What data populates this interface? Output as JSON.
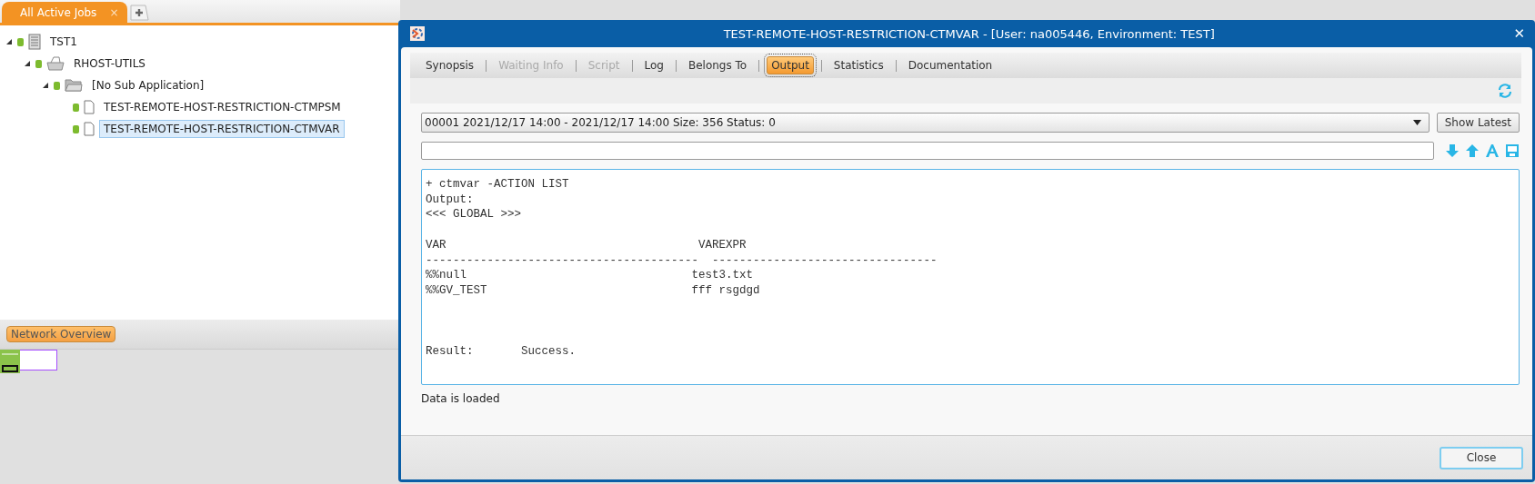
{
  "top_tabs": [
    {
      "label": "All Active Jobs",
      "selected": true,
      "close": "×"
    }
  ],
  "tree": [
    {
      "label": "TST1",
      "kind": "server",
      "expanded": true,
      "selected": false,
      "color": "#7dbb2e",
      "children": [
        {
          "label": "RHOST-UTILS",
          "kind": "application",
          "expanded": true,
          "selected": false,
          "color": "#7dbb2e",
          "children": [
            {
              "label": "[No Sub Application]",
              "kind": "folder",
              "expanded": true,
              "selected": false,
              "color": "#7dbb2e",
              "children": [
                {
                  "label": "TEST-REMOTE-HOST-RESTRICTION-CTMPSM",
                  "kind": "job",
                  "selected": false,
                  "color": "#7dbb2e"
                },
                {
                  "label": "TEST-REMOTE-HOST-RESTRICTION-CTMVAR",
                  "kind": "job",
                  "selected": true,
                  "color": "#7dbb2e"
                }
              ]
            }
          ]
        }
      ]
    }
  ],
  "network_overview": {
    "label": "Network Overview"
  },
  "dialog": {
    "title": "TEST-REMOTE-HOST-RESTRICTION-CTMVAR - [User: na005446, Environment: TEST]",
    "close": "✕",
    "tabs": [
      {
        "label": "Synopsis",
        "selected": false,
        "disabled": false
      },
      {
        "label": "Waiting Info",
        "selected": false,
        "disabled": true
      },
      {
        "label": "Script",
        "selected": false,
        "disabled": true
      },
      {
        "label": "Log",
        "selected": false,
        "disabled": false
      },
      {
        "label": "Belongs To",
        "selected": false,
        "disabled": false
      },
      {
        "label": "Output",
        "selected": true,
        "disabled": false
      },
      {
        "label": "Statistics",
        "selected": false,
        "disabled": false
      },
      {
        "label": "Documentation",
        "selected": false,
        "disabled": false
      }
    ],
    "run_select": {
      "value": "00001 2021/12/17 14:00 - 2021/12/17 14:00 Size: 356 Status: 0"
    },
    "show_latest": "Show Latest",
    "output_blocks": [
      [
        "+ ctmvar -ACTION LIST",
        "Output:",
        "<<< GLOBAL >>>"
      ],
      [
        "VAR                                     VAREXPR",
        "----------------------------------------  ---------------------------------",
        "%%null                                 test3.txt",
        "%%GV_TEST                              fff rsgdgd"
      ],
      [
        "Result:       Success."
      ]
    ],
    "status": "Data is loaded",
    "close_button": "Close"
  }
}
